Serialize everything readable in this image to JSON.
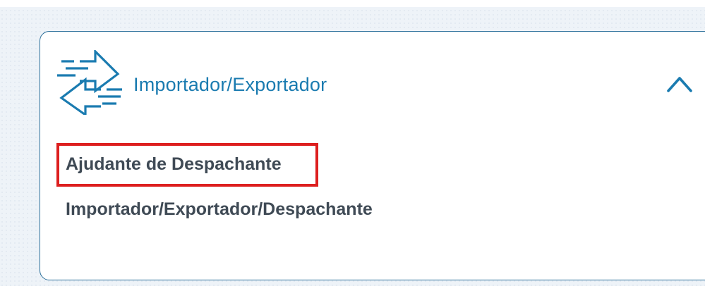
{
  "accordion": {
    "title": "Importador/Exportador",
    "icon": "import-export-arrows-icon",
    "toggle_icon": "chevron-up-icon",
    "expanded": true,
    "options": [
      {
        "label": "Ajudante de Despachante",
        "highlighted": true
      },
      {
        "label": "Importador/Exportador/Despachante",
        "highlighted": false
      }
    ]
  },
  "colors": {
    "accent": "#1a7bb0",
    "border": "#2b6f9a",
    "text": "#3f4a55",
    "highlight": "#dd1f1f"
  }
}
